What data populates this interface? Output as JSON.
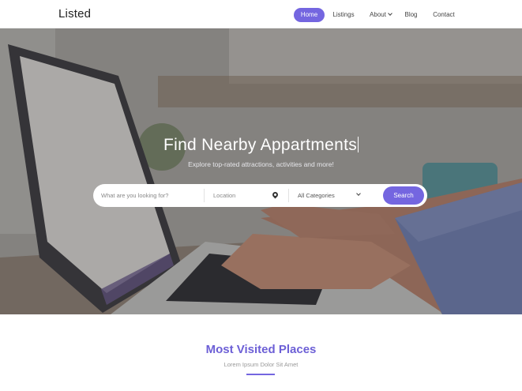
{
  "brand": {
    "logo": "Listed"
  },
  "nav": {
    "items": [
      {
        "label": "Home",
        "active": true
      },
      {
        "label": "Listings",
        "active": false
      },
      {
        "label": "About",
        "active": false,
        "dropdown": true
      },
      {
        "label": "Blog",
        "active": false
      },
      {
        "label": "Contact",
        "active": false
      }
    ]
  },
  "hero": {
    "title": "Find Nearby Appartments",
    "subtitle": "Explore top-rated attractions, activities and more!",
    "image": "laptop-hands-typing"
  },
  "search": {
    "keyword_placeholder": "What are you looking for?",
    "location_placeholder": "Location",
    "category_selected": "All Categories",
    "button_label": "Search",
    "location_icon": "map-pin-icon",
    "category_icon": "chevron-down-icon"
  },
  "section": {
    "title": "Most Visited Places",
    "subtitle": "Lorem Ipsum Dolor Sit Amet"
  },
  "colors": {
    "accent": "#7466e0",
    "title": "#6c5fd6"
  }
}
